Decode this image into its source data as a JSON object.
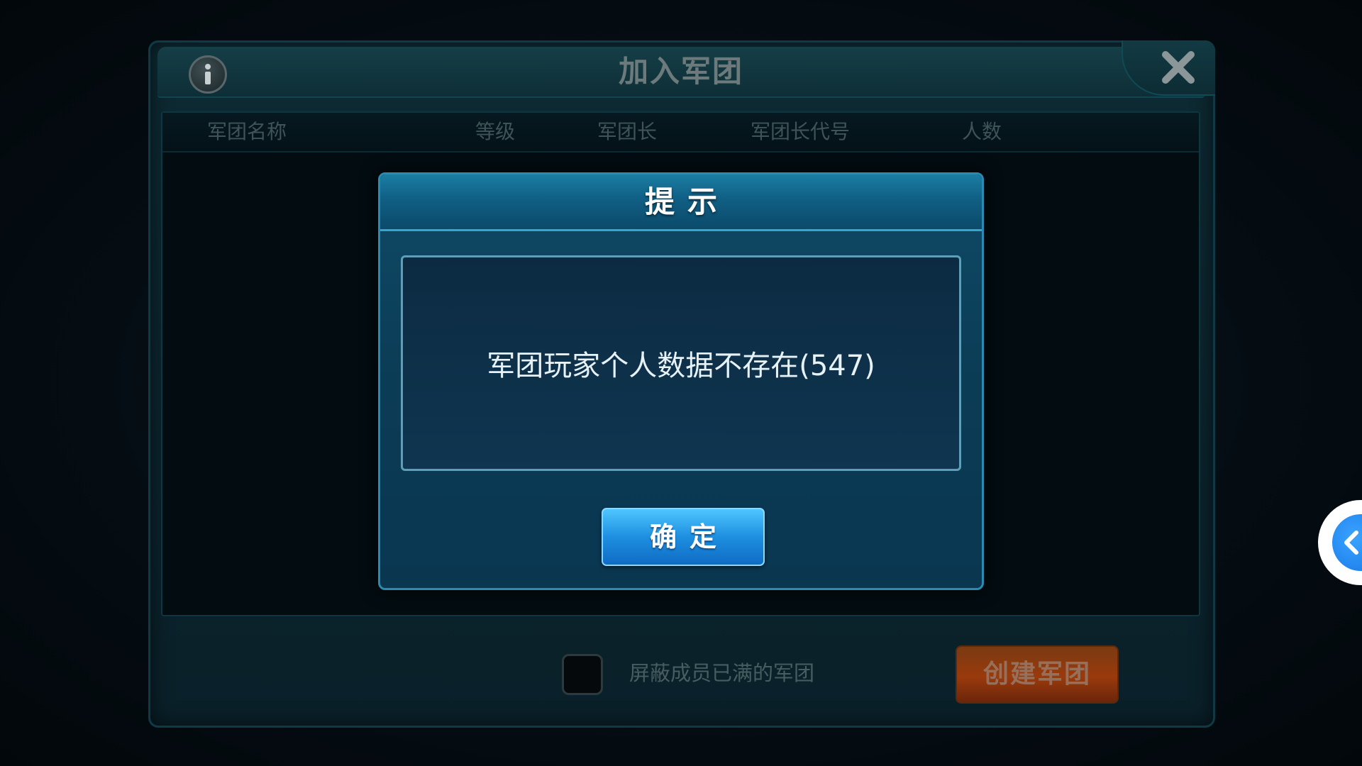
{
  "main_window": {
    "title": "加入军团",
    "columns": [
      "军团名称",
      "等级",
      "军团长",
      "军团长代号",
      "人数"
    ],
    "filter_label": "屏蔽成员已满的军团",
    "create_button_label": "创建军团"
  },
  "dialog": {
    "title": "提示",
    "message": "军团玩家个人数据不存在(547)",
    "ok_button_label": "确定"
  },
  "icons": {
    "info": "info-icon",
    "close": "close-icon",
    "side_tab": "chevron-left-icon"
  },
  "colors": {
    "dialog_accent": "#2a8ab0",
    "ok_button": "#1e8fe0",
    "create_button": "#9a3a0c"
  }
}
